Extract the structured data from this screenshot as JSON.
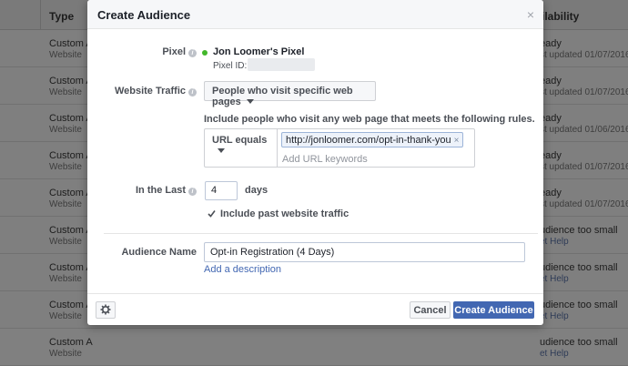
{
  "background": {
    "header_type": "Type",
    "header_availability": "ilability",
    "rows": [
      {
        "type": "Custom A",
        "sub": "Website",
        "avail": "eady",
        "avail_sub": "st updated 01/07/2016"
      },
      {
        "type": "Custom A",
        "sub": "Website",
        "avail": "eady",
        "avail_sub": "st updated 01/07/2016"
      },
      {
        "type": "Custom A",
        "sub": "Website",
        "avail": "eady",
        "avail_sub": "st updated 01/06/2016"
      },
      {
        "type": "Custom A",
        "sub": "Website",
        "avail": "eady",
        "avail_sub": "st updated 01/07/2016"
      },
      {
        "type": "Custom A",
        "sub": "Website",
        "avail": "eady",
        "avail_sub": "st updated 01/07/2016"
      },
      {
        "type": "Custom A",
        "sub": "Website",
        "avail": "udience too small",
        "avail_sub": "et Help"
      },
      {
        "type": "Custom A",
        "sub": "Website",
        "avail": "udience too small",
        "avail_sub": "et Help"
      },
      {
        "type": "Custom A",
        "sub": "Website",
        "avail": "udience too small",
        "avail_sub": "et Help"
      },
      {
        "type": "Custom A",
        "sub": "Website",
        "avail": "udience too small",
        "avail_sub": "et Help"
      }
    ]
  },
  "modal": {
    "title": "Create Audience",
    "close": "×",
    "pixel_label": "Pixel",
    "pixel_name": "Jon Loomer's Pixel",
    "pixel_id_label": "Pixel ID: 1",
    "website_traffic_label": "Website Traffic",
    "website_traffic_value": "People who visit specific web pages",
    "rules_text": "Include people who visit any web page that meets the following rules.",
    "url_operator": "URL equals",
    "url_tag": "http://jonloomer.com/opt-in-thank-you",
    "url_tag_remove": "×",
    "url_placeholder": "Add URL keywords",
    "in_the_last_label": "In the Last",
    "days_value": "4",
    "days_label": "days",
    "include_past_label": "Include past website traffic",
    "audience_name_label": "Audience Name",
    "audience_name_value": "Opt-in Registration (4 Days)",
    "add_description": "Add a description",
    "cancel": "Cancel",
    "create": "Create Audience"
  },
  "colors": {
    "primary": "#4267b2",
    "status_green": "#42b72a"
  }
}
